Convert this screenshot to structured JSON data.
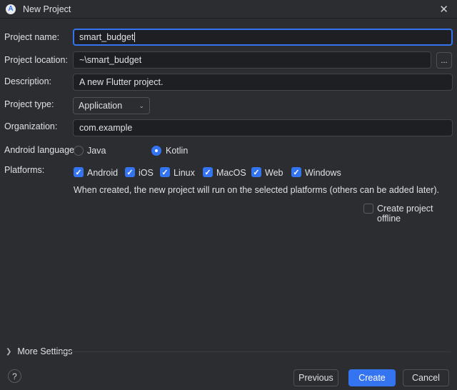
{
  "window": {
    "title": "New Project",
    "logo": "A",
    "close_icon": "✕"
  },
  "form": {
    "name_label": "Project name:",
    "name_value": "smart_budget",
    "location_label": "Project location:",
    "location_value": "~\\smart_budget",
    "browse_label": "...",
    "description_label": "Description:",
    "description_value": "A new Flutter project.",
    "type_label": "Project type:",
    "type_value": "Application",
    "org_label": "Organization:",
    "org_value": "com.example",
    "lang_label": "Android language:",
    "lang_options": [
      "Java",
      "Kotlin"
    ],
    "lang_selected": "Kotlin",
    "platforms_label": "Platforms:",
    "platforms": [
      {
        "label": "Android",
        "checked": true
      },
      {
        "label": "iOS",
        "checked": true
      },
      {
        "label": "Linux",
        "checked": true
      },
      {
        "label": "MacOS",
        "checked": true
      },
      {
        "label": "Web",
        "checked": true
      },
      {
        "label": "Windows",
        "checked": true
      }
    ],
    "platforms_note": "When created, the new project will run on the selected platforms (others can be added later).",
    "offline_label": "Create project offline",
    "offline_checked": false
  },
  "footer": {
    "more_settings": "More Settings",
    "help": "?",
    "previous": "Previous",
    "create": "Create",
    "cancel": "Cancel"
  },
  "colors": {
    "accent": "#3574f0",
    "background": "#2b2d30",
    "input_bg": "#1e1f22"
  }
}
